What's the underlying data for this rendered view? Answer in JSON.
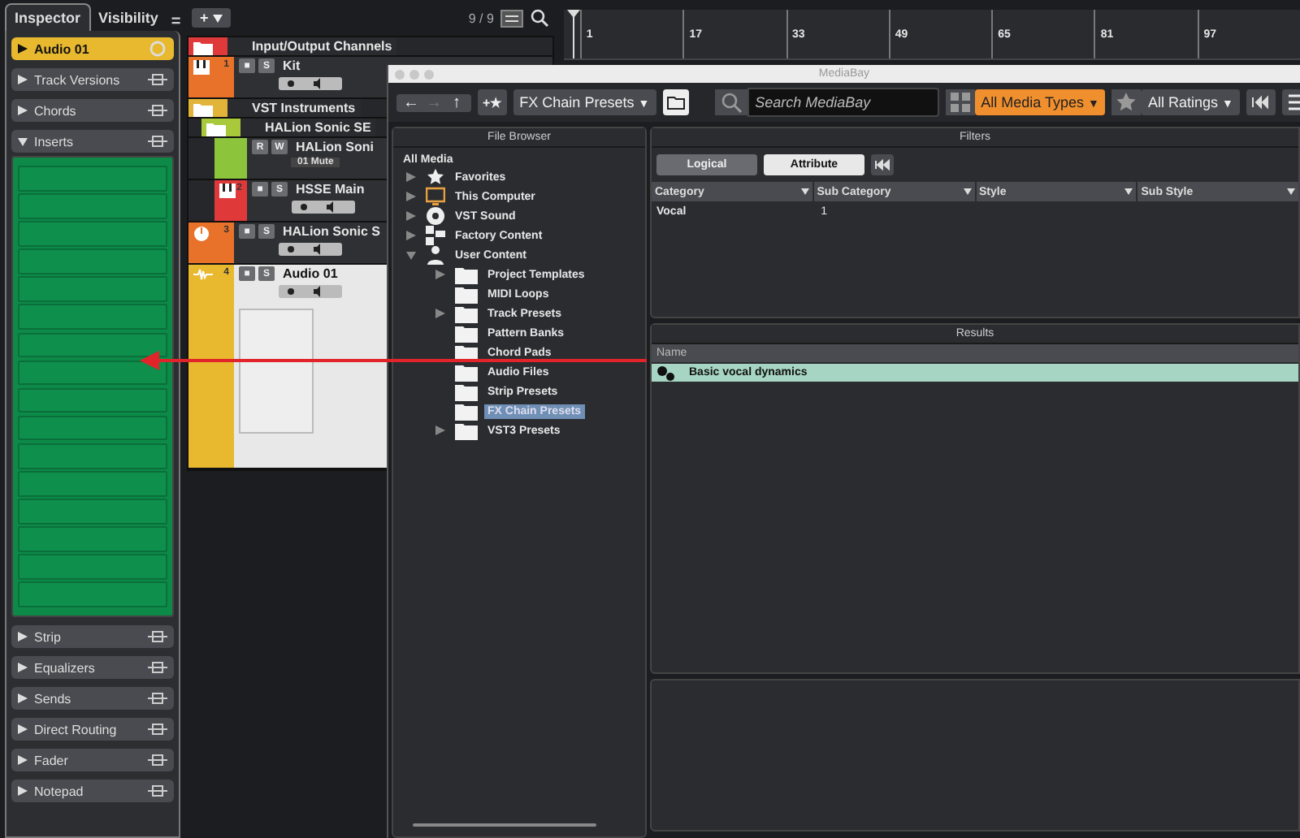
{
  "inspector": {
    "tabs": [
      {
        "label": "Inspector",
        "selected": true
      },
      {
        "label": "Visibility",
        "selected": false
      }
    ],
    "menu": "=",
    "sections": [
      {
        "label": "Audio 01",
        "kind": "track",
        "expanded": false
      },
      {
        "label": "Track Versions",
        "kind": "section",
        "expanded": false
      },
      {
        "label": "Chords",
        "kind": "section",
        "expanded": false
      },
      {
        "label": "Inserts",
        "kind": "inserts",
        "expanded": true
      },
      {
        "label": "Strip",
        "kind": "section",
        "expanded": false
      },
      {
        "label": "Equalizers",
        "kind": "section",
        "expanded": false
      },
      {
        "label": "Sends",
        "kind": "section",
        "expanded": false
      },
      {
        "label": "Direct Routing",
        "kind": "section",
        "expanded": false
      },
      {
        "label": "Fader",
        "kind": "section",
        "expanded": false
      },
      {
        "label": "Notepad",
        "kind": "section",
        "expanded": false
      }
    ]
  },
  "project": {
    "add_button": "+",
    "count": "9 / 9",
    "tracks": [
      {
        "name": "Input/Output Channels",
        "kind": "folder",
        "color": "#e0393a"
      },
      {
        "name": "Kit",
        "number": "1",
        "kind": "instrument",
        "color": "#e8722a",
        "buttons": [
          "■",
          "S"
        ]
      },
      {
        "name": "VST Instruments",
        "kind": "folder",
        "color": "#e3b43a",
        "children": [
          {
            "name": "HALion Sonic SE",
            "kind": "folder",
            "color": "#a8c93a",
            "children": [
              {
                "name": "HALion Soni",
                "kind": "channel",
                "color": "#8cc43c",
                "buttons": [
                  "R",
                  "W"
                ],
                "field": "01 Mute"
              },
              {
                "name": "HSSE Main",
                "number": "2",
                "kind": "instrument",
                "color": "#e0393a",
                "buttons": [
                  "■",
                  "S"
                ]
              }
            ]
          }
        ]
      },
      {
        "name": "HALion Sonic S",
        "number": "3",
        "kind": "rack",
        "color": "#e8722a",
        "buttons": [
          "■",
          "S"
        ]
      },
      {
        "name": "Audio 01",
        "number": "4",
        "kind": "audio",
        "color": "#e8b92f",
        "buttons": [
          "■",
          "S"
        ]
      }
    ]
  },
  "ruler": {
    "ticks": [
      "1",
      "17",
      "33",
      "49",
      "65",
      "81",
      "97"
    ]
  },
  "mediabay": {
    "title": "MediaBay",
    "nav": [
      {
        "label": "←",
        "disabled": false
      },
      {
        "label": "→",
        "disabled": true
      },
      {
        "label": "↑",
        "disabled": false
      }
    ],
    "favorite_button": "+★",
    "location": "FX Chain Presets",
    "dropdown": "▼",
    "search": {
      "placeholder": "Search MediaBay"
    },
    "media_types": "All Media Types",
    "ratings": "All Ratings",
    "file_browser": {
      "title": "File Browser",
      "root": "All Media",
      "items": [
        {
          "label": "Favorites",
          "kind": "star",
          "expanded": false
        },
        {
          "label": "This Computer",
          "kind": "computer",
          "expanded": false
        },
        {
          "label": "VST Sound",
          "kind": "disc",
          "expanded": false
        },
        {
          "label": "Factory Content",
          "kind": "content",
          "expanded": false
        },
        {
          "label": "User Content",
          "kind": "user",
          "expanded": true,
          "children": [
            {
              "label": "Project Templates",
              "kind": "folder",
              "expanded": false,
              "selected": false
            },
            {
              "label": "MIDI Loops",
              "kind": "folder",
              "selected": false
            },
            {
              "label": "Track Presets",
              "kind": "folder",
              "expanded": false,
              "selected": false
            },
            {
              "label": "Pattern Banks",
              "kind": "folder",
              "selected": false
            },
            {
              "label": "Chord Pads",
              "kind": "folder",
              "selected": false
            },
            {
              "label": "Audio Files",
              "kind": "folder",
              "selected": false
            },
            {
              "label": "Strip Presets",
              "kind": "folder",
              "selected": false
            },
            {
              "label": "FX Chain Presets",
              "kind": "folder",
              "selected": true
            },
            {
              "label": "VST3 Presets",
              "kind": "folder",
              "expanded": false,
              "selected": false
            }
          ]
        }
      ]
    },
    "filters": {
      "title": "Filters",
      "modes": [
        {
          "label": "Logical",
          "selected": false
        },
        {
          "label": "Attribute",
          "selected": true
        }
      ],
      "columns": [
        "Category",
        "Sub Category",
        "Style",
        "Sub Style"
      ],
      "rows": [
        {
          "value": "Vocal",
          "count": "1"
        }
      ]
    },
    "results": {
      "title": "Results",
      "columns": [
        "Name"
      ],
      "rows": [
        {
          "name": "Basic vocal dynamics",
          "selected": true
        }
      ]
    }
  }
}
